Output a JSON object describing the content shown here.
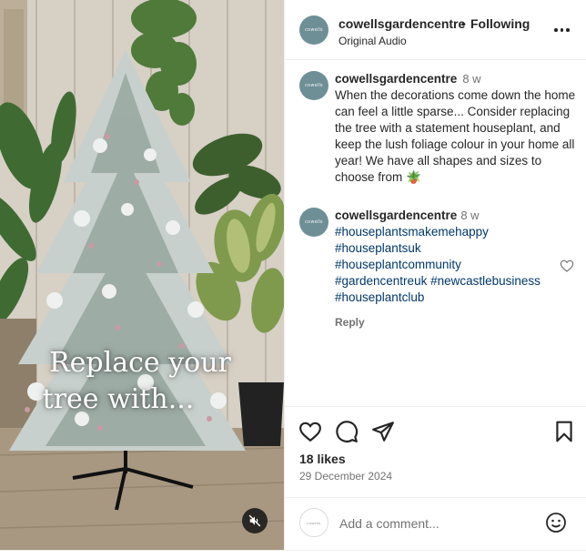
{
  "media": {
    "overlay_line1": "Replace your",
    "overlay_line2": "tree with..."
  },
  "header": {
    "avatar_text": "cowells",
    "username": "cowellsgardencentre",
    "separator": "•",
    "follow_state": "Following",
    "audio": "Original Audio"
  },
  "caption": {
    "username": "cowellsgardencentre",
    "time": "8 w",
    "text": "When the decorations come down the home can feel a little sparse... Consider replacing the tree with a statement houseplant, and keep the lush foliage colour in your home all year! We have all shapes and sizes to choose from 🪴"
  },
  "reply": {
    "username": "cowellsgardencentre",
    "time": "8 w",
    "tags": [
      "#houseplantsmakemehappy",
      "#houseplantsuk",
      "#houseplantcommunity",
      "#gardencentreuk",
      "#newcastlebusiness",
      "#houseplantclub"
    ],
    "reply_label": "Reply"
  },
  "actions": {
    "likes": "18 likes",
    "date": "29 December 2024"
  },
  "add_comment": {
    "placeholder": "Add a comment..."
  },
  "icons": {
    "like": "heart-icon",
    "comment": "comment-bubble-icon",
    "share": "send-icon",
    "save": "bookmark-icon",
    "more": "more-dots-icon",
    "mute": "speaker-muted-icon",
    "emoji": "emoji-icon"
  },
  "colors": {
    "link": "#00376b",
    "secondary_text": "#737373",
    "primary_text": "#262626",
    "avatar_bg": "#6f8f97"
  }
}
